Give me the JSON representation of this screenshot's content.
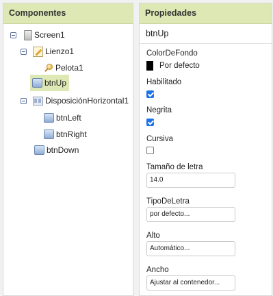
{
  "components": {
    "header": "Componentes",
    "tree": {
      "screen": "Screen1",
      "canvas": "Lienzo1",
      "ball": "Pelota1",
      "btn_up": "btnUp",
      "harr": "DisposiciónHorizontal1",
      "btn_left": "btnLeft",
      "btn_right": "btnRight",
      "btn_down": "btnDown"
    }
  },
  "properties": {
    "header": "Propiedades",
    "component_name": "btnUp",
    "bg_color": {
      "label": "ColorDeFondo",
      "value": "Por defecto",
      "swatch": "#000000"
    },
    "enabled": {
      "label": "Habilitado",
      "checked": true
    },
    "bold": {
      "label": "Negrita",
      "checked": true
    },
    "italic": {
      "label": "Cursiva",
      "checked": false
    },
    "font_size": {
      "label": "Tamaño de letra",
      "value": "14.0"
    },
    "font_typeface": {
      "label": "TipoDeLetra",
      "value": "por defecto..."
    },
    "height": {
      "label": "Alto",
      "value": "Automático..."
    },
    "width": {
      "label": "Ancho",
      "value": "Ajustar al contenedor..."
    }
  },
  "colors": {
    "header_bg": "#dde8b4",
    "selected_bg": "#dde8b4",
    "checkbox_on": "#1a73e8"
  }
}
